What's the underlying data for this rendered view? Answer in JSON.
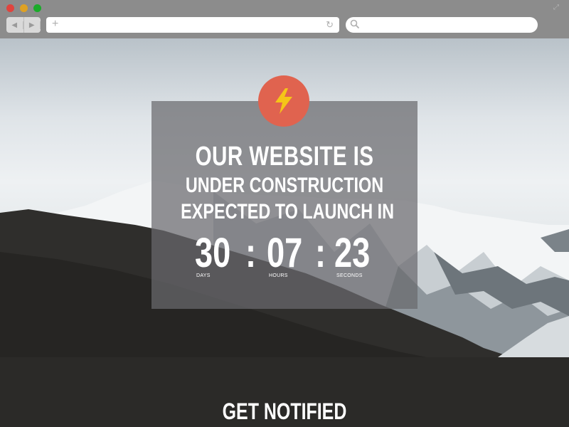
{
  "browser": {
    "window_buttons": [
      "close",
      "minimize",
      "maximize"
    ],
    "url": "",
    "search_placeholder": ""
  },
  "hero": {
    "badge_icon": "lightning-bolt-icon",
    "headline_1": "OUR WEBSITE IS",
    "headline_2": "UNDER CONSTRUCTION",
    "headline_3": "EXPECTED TO LAUNCH IN",
    "countdown": {
      "days": "30",
      "hours": "07",
      "seconds": "23",
      "separator": ":",
      "days_label": "DAYS",
      "hours_label": "HOURS",
      "seconds_label": "SECONDS"
    }
  },
  "cta": {
    "title": "GET NOTIFIED"
  },
  "colors": {
    "badge": "#e0634f",
    "bolt": "#f5c518",
    "panel": "#69696e",
    "dark_bg": "#2b2a28"
  }
}
